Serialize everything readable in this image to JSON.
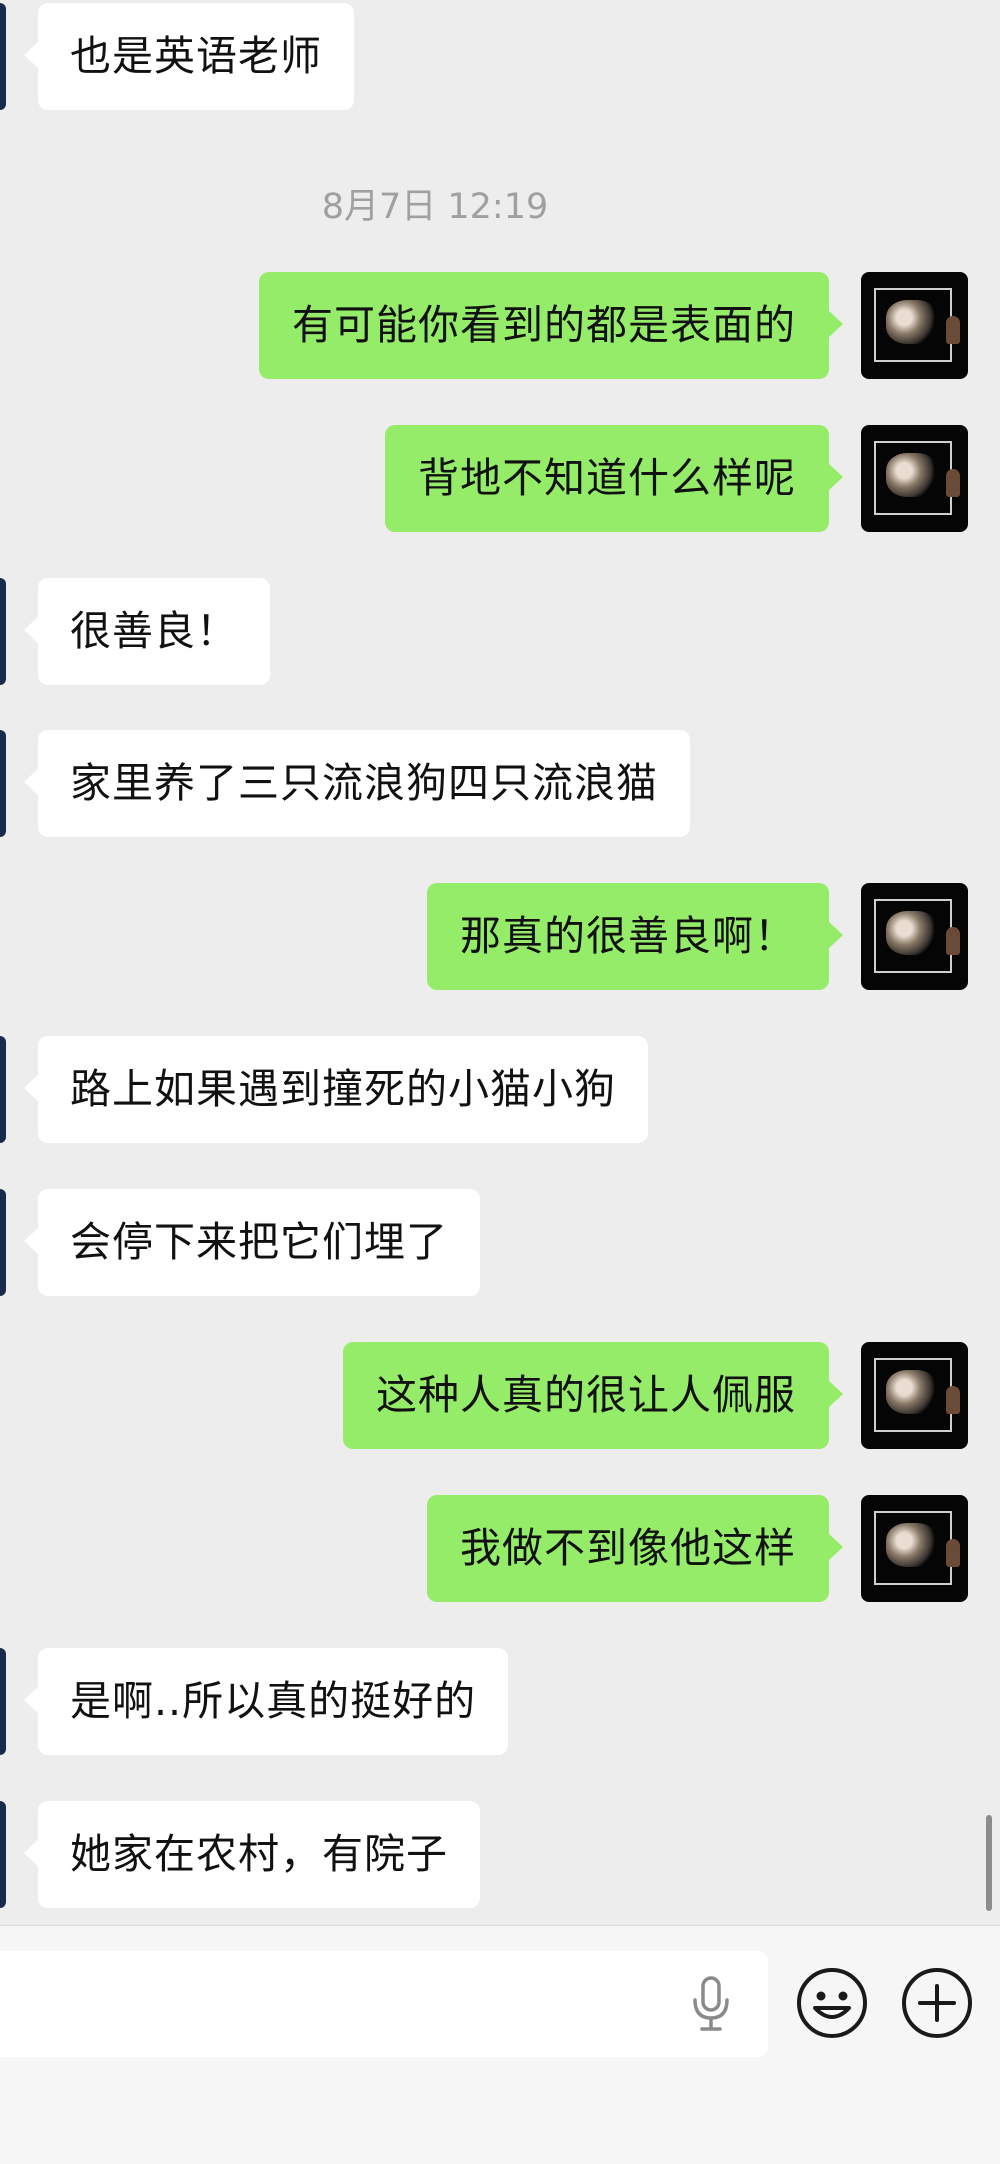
{
  "timestamp": "8月7日 12:19",
  "messages": [
    {
      "side": "in",
      "text": "也是英语老师"
    },
    {
      "side": "out",
      "text": "有可能你看到的都是表面的"
    },
    {
      "side": "out",
      "text": "背地不知道什么样呢"
    },
    {
      "side": "in",
      "text": "很善良！"
    },
    {
      "side": "in",
      "text": "家里养了三只流浪狗四只流浪猫"
    },
    {
      "side": "out",
      "text": "那真的很善良啊！"
    },
    {
      "side": "in",
      "text": "路上如果遇到撞死的小猫小狗"
    },
    {
      "side": "in",
      "text": "会停下来把它们埋了"
    },
    {
      "side": "out",
      "text": "这种人真的很让人佩服"
    },
    {
      "side": "out",
      "text": "我做不到像他这样"
    },
    {
      "side": "in",
      "text": "是啊..所以真的挺好的"
    },
    {
      "side": "in",
      "text": "她家在农村，有院子"
    }
  ],
  "input_bar": {
    "icons": [
      "microphone-icon",
      "emoji-icon",
      "plus-icon"
    ]
  },
  "colors": {
    "background": "#ededed",
    "outgoing_bubble": "#95ec69",
    "incoming_bubble": "#ffffff",
    "timestamp_text": "#a0a0a0"
  }
}
